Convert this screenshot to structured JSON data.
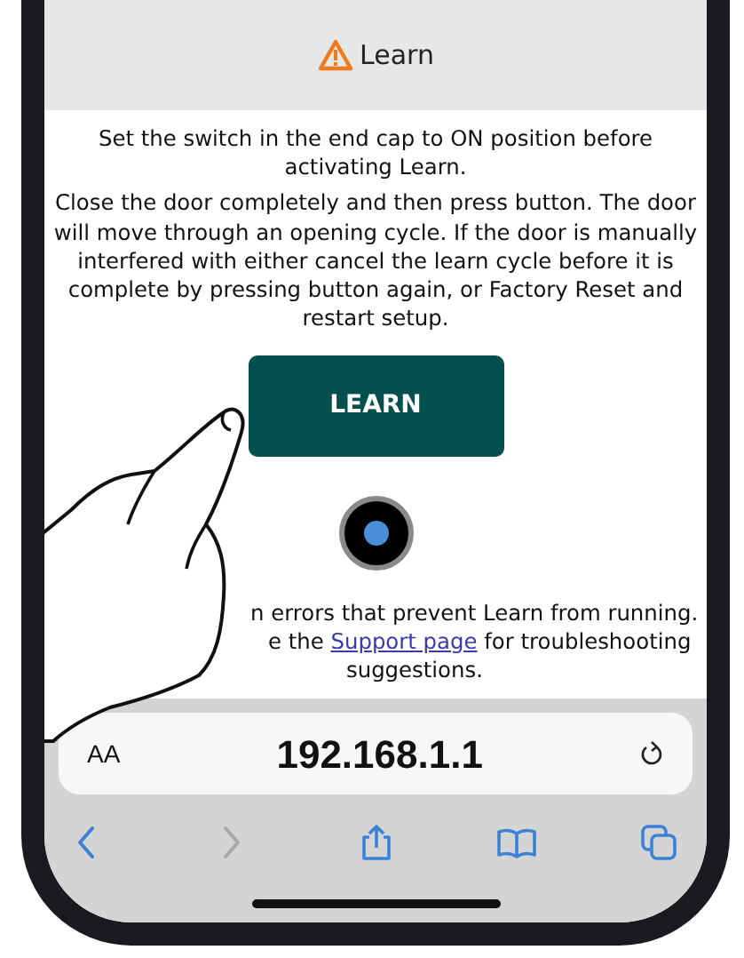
{
  "header": {
    "title": "Learn"
  },
  "instructions": [
    "Set the switch in the end cap to ON position before activating Learn.",
    "Close the door completely and then press button. The door will move through an opening cycle. If the door is manually interfered with either cancel the learn cycle before it is complete by pressing button again, or Factory Reset and restart setup."
  ],
  "learn_button": "LEARN",
  "note": {
    "line_1": "n errors that prevent Learn from running.",
    "line_2_before": "e the",
    "link": "Support page",
    "line_2_after": "for troubleshooting",
    "line_3": "suggestions."
  },
  "address_bar": {
    "text_size": "AA",
    "url": "192.168.1.1"
  },
  "toolbar": [
    {
      "kind": "back",
      "disabled": false
    },
    {
      "kind": "forward",
      "disabled": true
    },
    {
      "kind": "share",
      "disabled": false
    },
    {
      "kind": "bookmarks",
      "disabled": false
    },
    {
      "kind": "tabs",
      "disabled": false
    }
  ]
}
